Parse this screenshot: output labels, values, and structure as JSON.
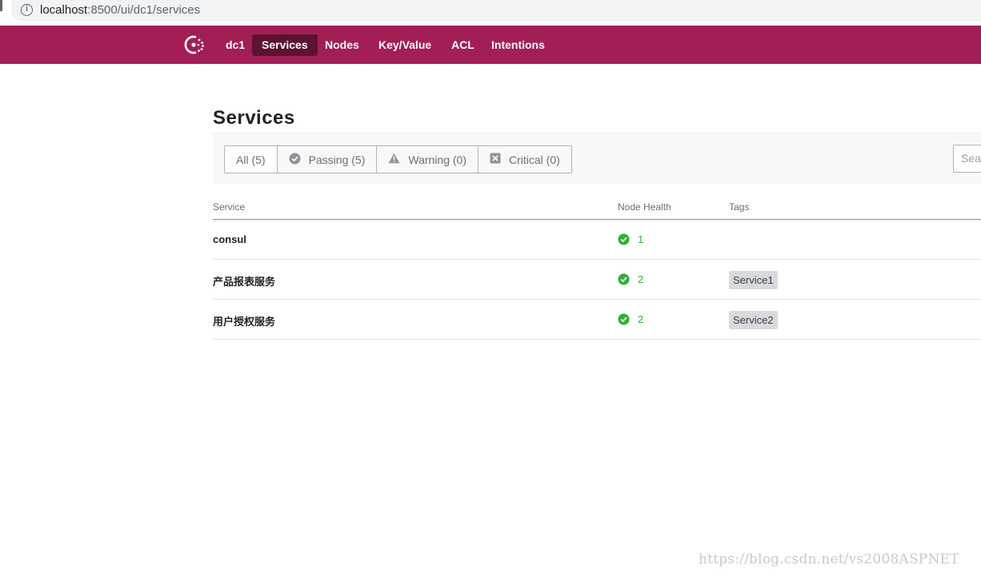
{
  "browser": {
    "url_host": "localhost",
    "url_rest": ":8500/ui/dc1/services",
    "info_icon": "info-icon"
  },
  "nav": {
    "logo_icon": "consul-logo-icon",
    "datacenter": "dc1",
    "items": [
      {
        "label": "Services",
        "active": true
      },
      {
        "label": "Nodes",
        "active": false
      },
      {
        "label": "Key/Value",
        "active": false
      },
      {
        "label": "ACL",
        "active": false
      },
      {
        "label": "Intentions",
        "active": false
      }
    ],
    "bar_color": "#a31e56",
    "active_color": "#5c1230"
  },
  "page": {
    "title": "Services"
  },
  "filters": [
    {
      "label": "All (5)",
      "icon": null,
      "active": true
    },
    {
      "label": "Passing (5)",
      "icon": "check-circle-icon",
      "active": false
    },
    {
      "label": "Warning (0)",
      "icon": "warning-triangle-icon",
      "active": false
    },
    {
      "label": "Critical (0)",
      "icon": "x-square-icon",
      "active": false
    }
  ],
  "search": {
    "placeholder": "Sear"
  },
  "table": {
    "headers": {
      "service": "Service",
      "health": "Node Health",
      "tags": "Tags"
    },
    "rows": [
      {
        "name": "consul",
        "health": "1",
        "tags": []
      },
      {
        "name": "产品报表服务",
        "health": "2",
        "tags": [
          "Service1"
        ]
      },
      {
        "name": "用户授权服务",
        "health": "2",
        "tags": [
          "Service2"
        ]
      }
    ],
    "passing_color": "#2eb039"
  },
  "watermark": "https://blog.csdn.net/vs2008ASPNET"
}
